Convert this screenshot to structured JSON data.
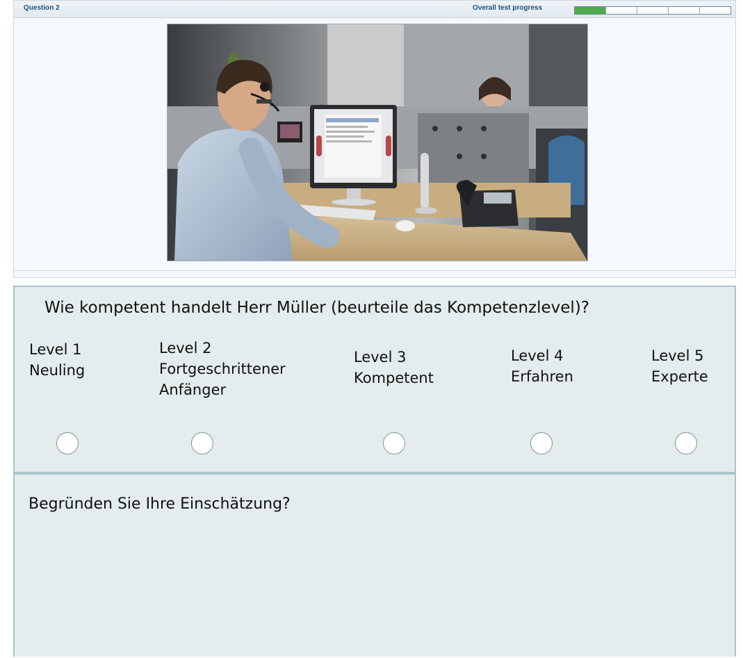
{
  "header": {
    "question_label": "Question 2",
    "progress_label": "Overall test progress",
    "progress_segments_total": 5,
    "progress_segments_done": 1,
    "progress_color": "#4fab4b"
  },
  "media": {
    "type": "photo",
    "icon": "office-headset-scene"
  },
  "rating": {
    "question": "Wie kompetent handelt Herr Müller (beurteile das Kompetenzlevel)?",
    "levels": [
      {
        "level": "Level 1",
        "name": "Neuling",
        "name2": ""
      },
      {
        "level": "Level 2",
        "name": "Fortgeschrittener",
        "name2": "Anfänger"
      },
      {
        "level": "Level 3",
        "name": "Kompetent",
        "name2": ""
      },
      {
        "level": "Level 4",
        "name": "Erfahren",
        "name2": ""
      },
      {
        "level": "Level 5",
        "name": "Experte",
        "name2": ""
      }
    ],
    "selected": null
  },
  "justification": {
    "label": "Begründen Sie Ihre Einschätzung?",
    "value": ""
  },
  "colors": {
    "panel_bg": "#e4ecee",
    "panel_border": "#a9c4c8",
    "header_text": "#1d4f7a"
  }
}
